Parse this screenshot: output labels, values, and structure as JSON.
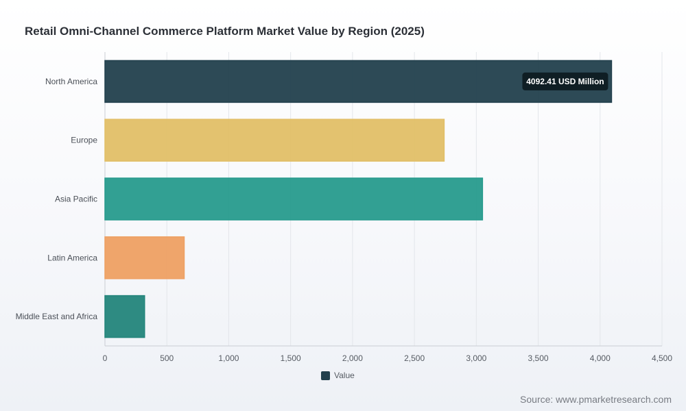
{
  "title": "Retail Omni-Channel Commerce Platform Market Value by Region (2025)",
  "source": "Source: www.pmarketresearch.com",
  "legend": {
    "label": "Value",
    "color": "#22404d"
  },
  "tooltip": {
    "text": "4092.41 USD Million"
  },
  "chart_data": {
    "type": "bar",
    "orientation": "horizontal",
    "categories": [
      "North America",
      "Europe",
      "Asia Pacific",
      "Latin America",
      "Middle East and Africa"
    ],
    "series": [
      {
        "name": "Value",
        "values": [
          4092.41,
          2740,
          3050,
          640,
          320
        ]
      }
    ],
    "colors": [
      "#22404d",
      "#e2bf67",
      "#279b8d",
      "#eea063",
      "#23857b"
    ],
    "xlim": [
      0,
      4500
    ],
    "xticks": [
      0,
      500,
      1000,
      1500,
      2000,
      2500,
      3000,
      3500,
      4000,
      4500
    ],
    "xtick_labels": [
      "0",
      "500",
      "1,000",
      "1,500",
      "2,000",
      "2,500",
      "3,000",
      "3,500",
      "4,000",
      "4,500"
    ],
    "grid": true,
    "legend_position": "bottom"
  }
}
